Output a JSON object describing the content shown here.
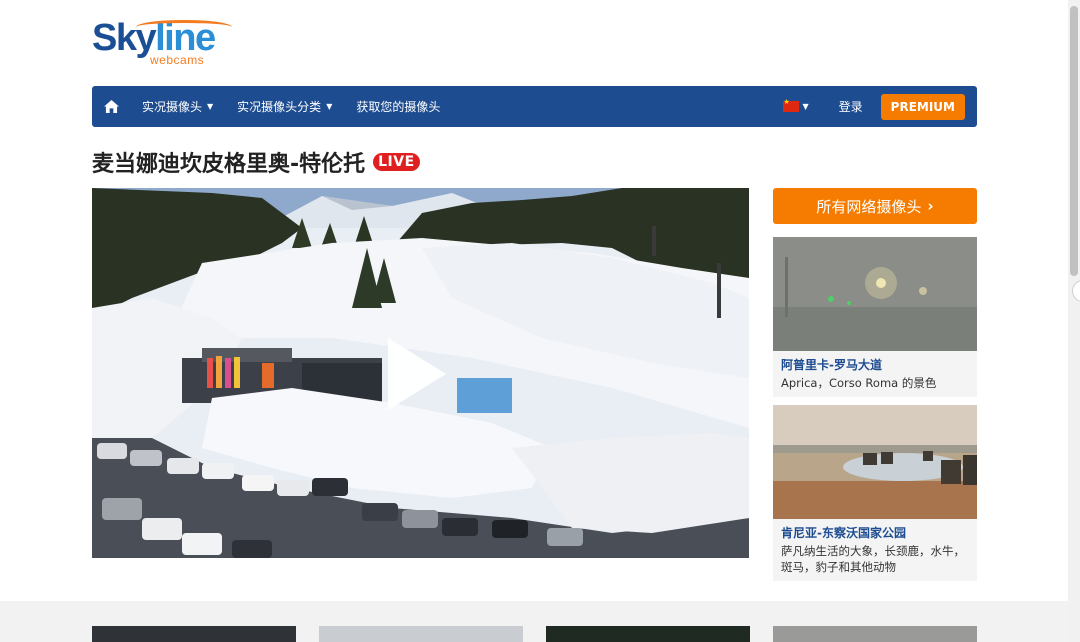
{
  "logo": {
    "part1": "Sky",
    "part2": "line",
    "sub": "webcams"
  },
  "nav": {
    "home_icon": "home-icon",
    "items": [
      {
        "label": "实况摄像头",
        "has_caret": true
      },
      {
        "label": "实况摄像头分类",
        "has_caret": true
      },
      {
        "label": "获取您的摄像头",
        "has_caret": false
      }
    ],
    "language_flag": "china-flag-icon",
    "login": "登录",
    "premium": "PREMIUM"
  },
  "page": {
    "title": "麦当娜迪坎皮格里奥-特伦托",
    "live": "LIVE"
  },
  "video": {
    "play_icon": "play-icon"
  },
  "sidebar": {
    "all_cams_label": "所有网络摄像头",
    "cards": [
      {
        "title": "阿普里卡-罗马大道",
        "desc": "Aprica，Corso Roma 的景色"
      },
      {
        "title": "肯尼亚-东察沃国家公园",
        "desc": "萨凡纳生活的大象，长颈鹿，水牛，斑马，豹子和其他动物"
      }
    ]
  },
  "colors": {
    "navbar": "#1d4c91",
    "accent_orange": "#f57c00",
    "live_red": "#e02020",
    "link_blue": "#1d4c91"
  }
}
